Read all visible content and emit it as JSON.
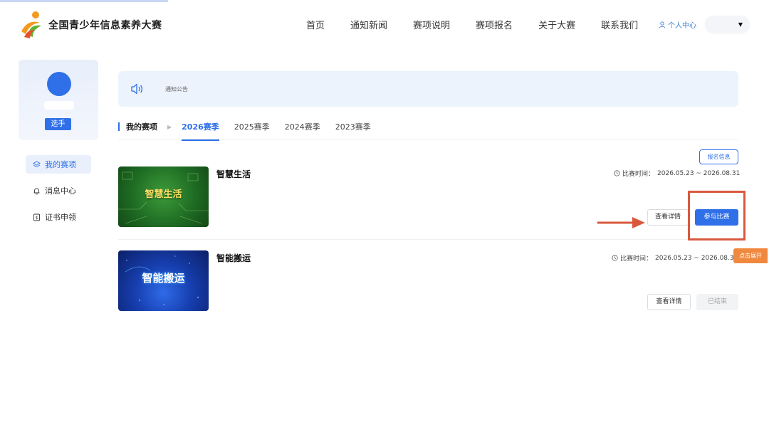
{
  "colors": {
    "brand_blue": "#2f6fe8",
    "highlight_red": "#d9593e",
    "expand_orange": "#f0883e"
  },
  "header": {
    "brand": "全国青少年信息素养大赛",
    "nav": [
      "首页",
      "通知新闻",
      "赛项说明",
      "赛项报名",
      "关于大赛",
      "联系我们"
    ],
    "user_center": "个人中心",
    "user_icon": "user-icon",
    "select_icon": "caret-down-icon"
  },
  "sidebar": {
    "role": "选手",
    "menu": [
      {
        "label": "我的赛项",
        "icon": "layers-icon",
        "active": true
      },
      {
        "label": "消息中心",
        "icon": "bell-icon",
        "active": false
      },
      {
        "label": "证书申领",
        "icon": "certificate-icon",
        "active": false
      }
    ]
  },
  "notice": {
    "icon": "speaker-icon",
    "text": "通知公告"
  },
  "tabs": {
    "title": "我的赛项",
    "seasons": [
      "2026赛季",
      "2025赛季",
      "2024赛季",
      "2023赛季"
    ],
    "active": "2026赛季"
  },
  "competitions": [
    {
      "name": "智慧生活",
      "thumb_title": "智慧生活",
      "time_label": "比赛时间：",
      "time_range": "2026.05.23 ~ 2026.08.31",
      "info_button": "报名信息",
      "details_button": "查看详情",
      "action_button": "参与比赛"
    },
    {
      "name": "智能搬运",
      "thumb_title": "智能搬运",
      "time_label": "比赛时间：",
      "time_range": "2026.05.23 ~ 2026.08.31",
      "details_button": "查看详情",
      "action_button": "已结束"
    }
  ],
  "expand_tab": "点击展开"
}
